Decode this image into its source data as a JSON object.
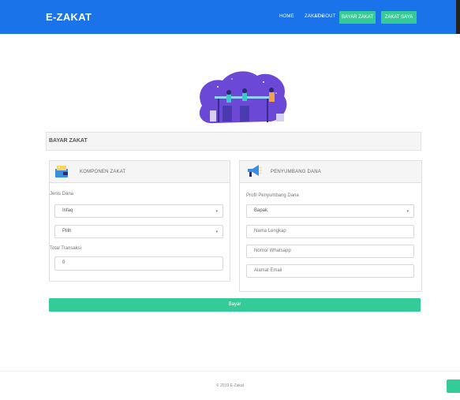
{
  "navbar": {
    "brand": "E-ZAKAT",
    "links": {
      "home": "HOME",
      "zakat": "ZAKAT",
      "logout": "LOGOUT"
    },
    "buttons": {
      "bayar_zakat": "BAYAR ZAKAT",
      "zakat_saya": "ZAKAT SAYA"
    },
    "color": "#1a73e8",
    "accent": "#33cc99"
  },
  "section": {
    "title": "BAYAR ZAKAT"
  },
  "komponen": {
    "title": "KOMPONEN ZAKAT",
    "icon": "wallet-icon",
    "jenis_label": "Jenis Dana",
    "jenis_value": "Infaq",
    "pilih_value": "Pilih",
    "total_label": "Total Transaksi",
    "total_value": "0"
  },
  "penyumbang": {
    "title": "PENYUMBANG DANA",
    "icon": "megaphone-icon",
    "profil_label": "Profil Penyumbang Dana",
    "profil_value": "Bapak",
    "nama_placeholder": "Nama Lengkap",
    "whatsapp_placeholder": "Nomor Whatsapp",
    "email_placeholder": "Alamat Email"
  },
  "submit_label": "Bayar",
  "footer": {
    "text": "© 2019 E-Zakat"
  }
}
